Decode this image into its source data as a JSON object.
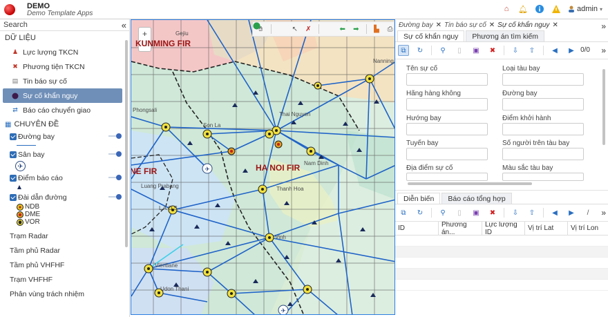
{
  "header": {
    "app_name": "DEMO",
    "app_subtitle": "Demo Template Apps",
    "user": "admin"
  },
  "sidebar": {
    "search_placeholder": "Search",
    "section_data": "DỮ LIỆU",
    "items": [
      {
        "label": "Lực lượng TKCN",
        "icon": "people-icon"
      },
      {
        "label": "Phương tiện TKCN",
        "icon": "tools-icon"
      },
      {
        "label": "Tin báo sự cố",
        "icon": "document-icon"
      },
      {
        "label": "Sự cố khẩn nguy",
        "icon": "alert-dot-icon"
      },
      {
        "label": "Báo cáo chuyển giao",
        "icon": "transfer-icon"
      }
    ],
    "section_topic": "CHUYÊN ĐỀ",
    "layers": [
      {
        "label": "Đường bay"
      },
      {
        "label": "Sân bay"
      },
      {
        "label": "Điểm báo cáo"
      },
      {
        "label": "Đài dẫn đường"
      }
    ],
    "legend": [
      "NDB",
      "DME",
      "VOR"
    ],
    "plain_items": [
      "Trạm Radar",
      "Tầm phủ Radar",
      "Tầm phủ VHFHF",
      "Trạm VHFHF",
      "Phân vùng trách nhiệm"
    ]
  },
  "map": {
    "labels": {
      "kunming": "KUNMING FIR",
      "hanoi": "HA NOI FIR",
      "vientiane": "NE FIR"
    },
    "places": [
      "Thai Nguyen",
      "Son La",
      "Nam Dinh",
      "Thanh Hoa",
      "Vinh",
      "Udon Thani",
      "Vientiane",
      "Phongsali",
      "Luang Prabang",
      "Nanning",
      "Gejiu",
      "L A O S"
    ]
  },
  "right_panel": {
    "breadcrumbs": [
      "Đường bay",
      "Tin báo sự cố",
      "Sự cố khẩn nguy"
    ],
    "tabs": [
      "Sự cố khẩn nguy",
      "Phương án tìm kiếm"
    ],
    "pager": "0/0",
    "form_fields": [
      "Tên sự cố",
      "Loại tàu bay",
      "Hãng hàng không",
      "Đường bay",
      "Hướng bay",
      "Điểm khởi hành",
      "Tuyến bay",
      "Số người trên tàu bay",
      "Địa điểm sự cố",
      "Màu sắc tàu bay"
    ],
    "bottom_tabs": [
      "Diễn biến",
      "Báo cáo tổng hợp"
    ],
    "columns": [
      "ID",
      "Phương án...",
      "Lực lượng ID",
      "Vị trí Lat",
      "Vị trí Lon"
    ]
  }
}
